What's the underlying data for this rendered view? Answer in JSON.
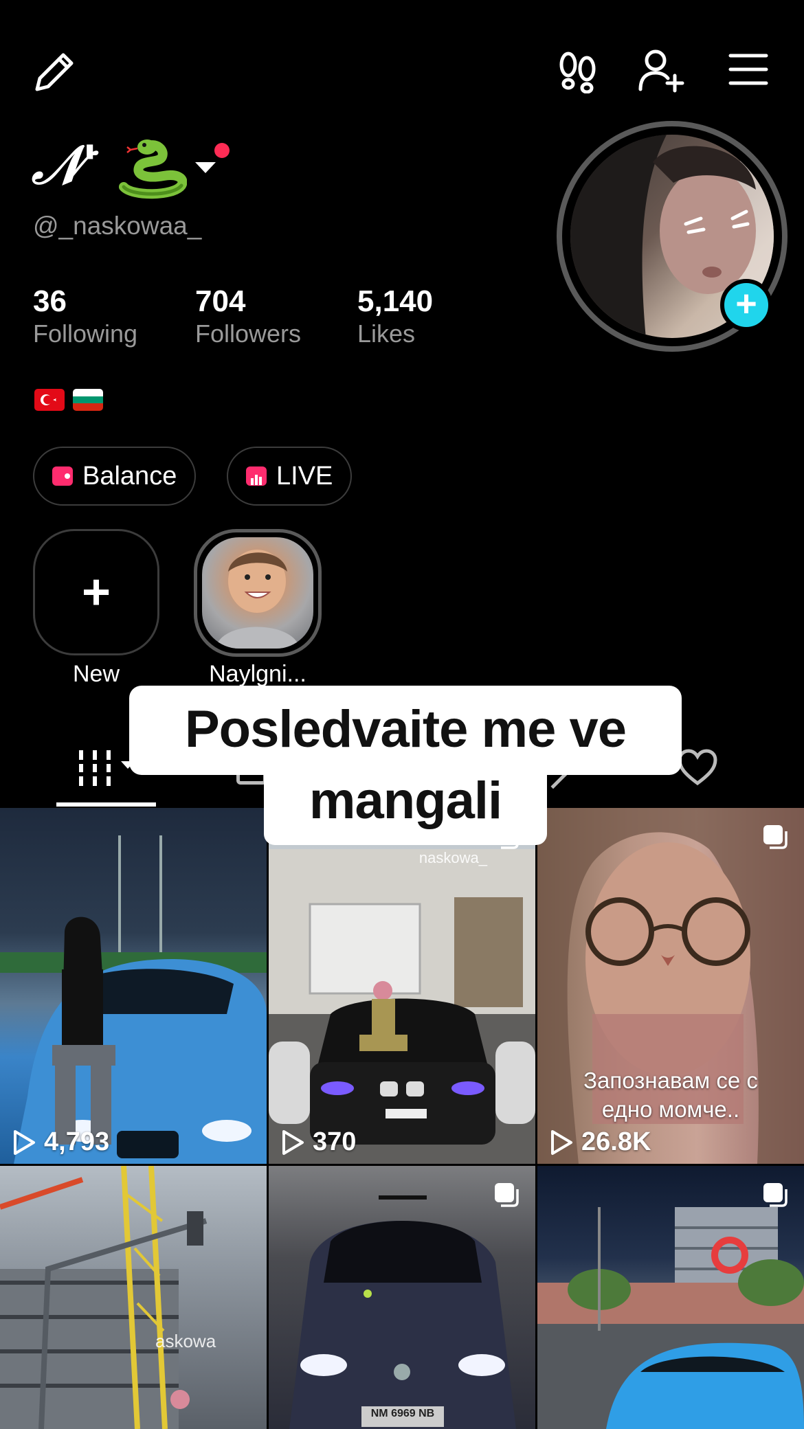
{
  "profile": {
    "display_name": "𝒩'",
    "username": "@_naskowaa_",
    "flags": [
      "Turkey flag",
      "Bulgaria flag"
    ]
  },
  "stats": [
    {
      "value": "36",
      "label": "Following"
    },
    {
      "value": "704",
      "label": "Followers"
    },
    {
      "value": "5,140",
      "label": "Likes"
    }
  ],
  "chips": {
    "balance": "Balance",
    "live": "LIVE"
  },
  "highlights": {
    "new_label": "New",
    "story_label": "Naylgni..."
  },
  "caption_overlay": {
    "line1": "Posledvaite me ve",
    "line2": "mangali"
  },
  "videos": [
    {
      "views": "4,793",
      "watermark": "",
      "caption": "",
      "multi": false
    },
    {
      "views": "370",
      "watermark": "naskowa_",
      "caption": "",
      "multi": true
    },
    {
      "views": "26.8K",
      "watermark": "",
      "caption_line1": "Запознавам се с",
      "caption_line2": "едно момче..",
      "multi": true
    },
    {
      "views": "",
      "watermark": "askowa",
      "caption": "",
      "multi": false
    },
    {
      "views": "",
      "watermark": "",
      "caption": "",
      "multi": true
    },
    {
      "views": "",
      "watermark": "",
      "caption": "",
      "multi": true
    }
  ],
  "icons": {
    "edit": "pencil-icon",
    "footprints": "footprints-icon",
    "add_friend": "add-user-icon",
    "menu": "hamburger-menu-icon"
  },
  "colors": {
    "accent_red": "#fe2c55",
    "plus_cyan": "#20d5ec",
    "chip_pink": "#fe2c6e"
  }
}
